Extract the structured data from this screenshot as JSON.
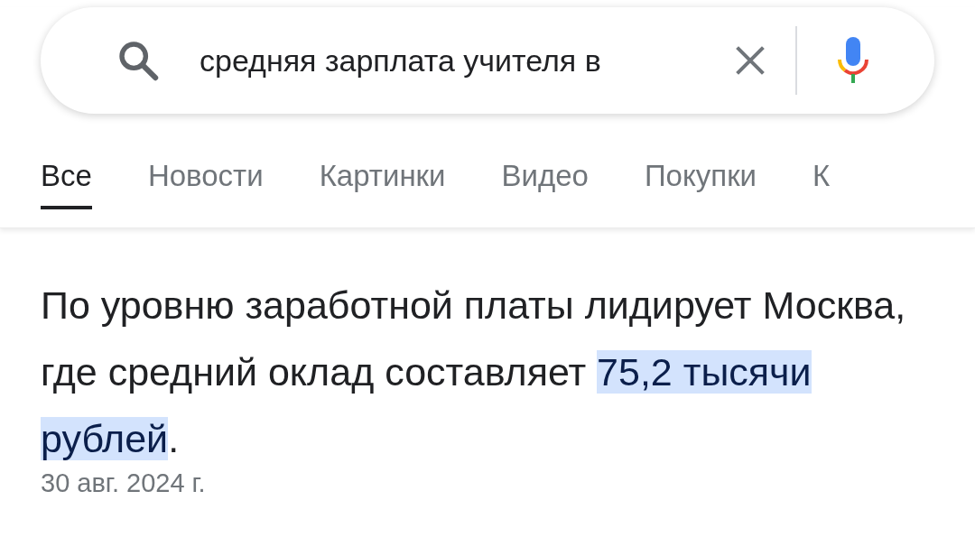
{
  "search": {
    "value": "средняя зарплата учителя в"
  },
  "tabs": [
    {
      "label": "Все",
      "selected": true
    },
    {
      "label": "Новости",
      "selected": false
    },
    {
      "label": "Картинки",
      "selected": false
    },
    {
      "label": "Видео",
      "selected": false
    },
    {
      "label": "Покупки",
      "selected": false
    },
    {
      "label": "К",
      "selected": false
    }
  ],
  "answer": {
    "parts": [
      {
        "text": "По уровню заработной платы лидирует Москва, где средний оклад составляет ",
        "highlighted": false
      },
      {
        "text": "75,2 тысячи рублей",
        "highlighted": true
      },
      {
        "text": ".",
        "highlighted": false
      }
    ],
    "date": "30 авг. 2024 г."
  }
}
